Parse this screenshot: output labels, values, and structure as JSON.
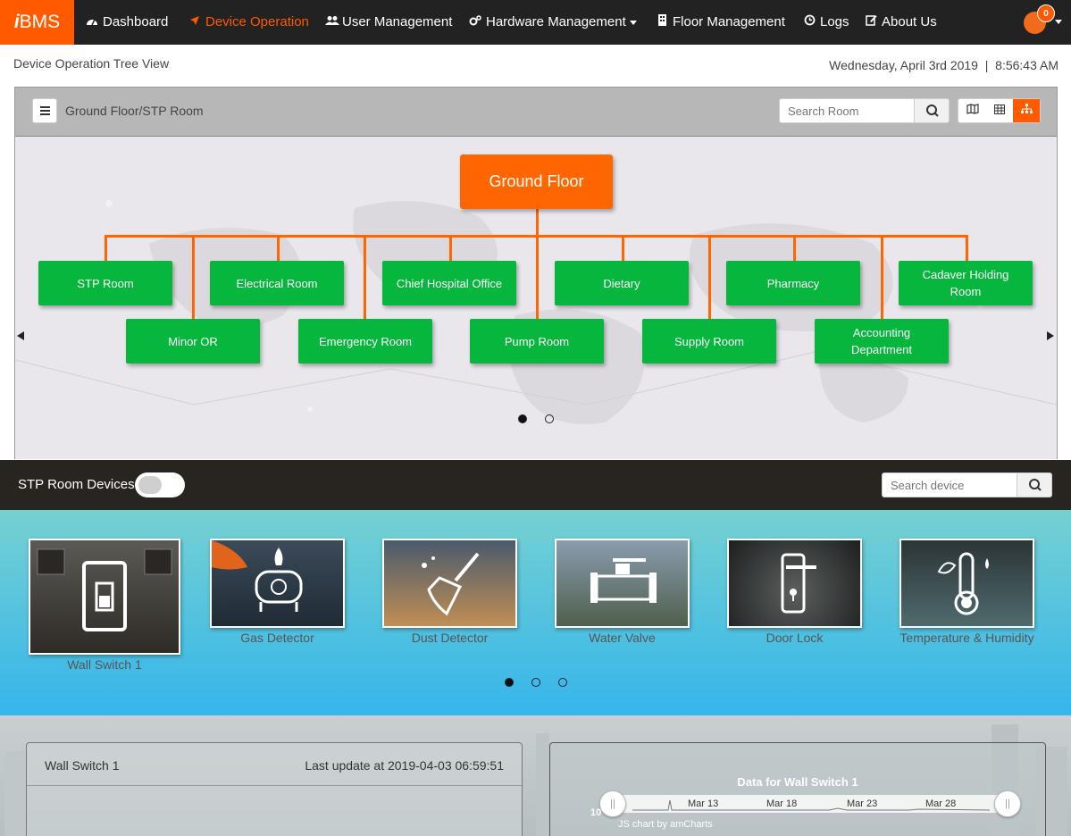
{
  "brand": {
    "prefix": "i",
    "name": "BMS"
  },
  "nav": {
    "dashboard": "Dashboard",
    "device_operation": "Device Operation",
    "user_management": "User Management",
    "hardware_management": "Hardware Management",
    "floor_management": "Floor Management",
    "logs": "Logs",
    "about_us": "About Us",
    "notification_count": "0"
  },
  "page": {
    "title": "Device Operation Tree View",
    "date": "Wednesday, April 3rd 2019",
    "separator": "|",
    "time": "8:56:43 AM"
  },
  "tree": {
    "breadcrumb": "Ground Floor/STP Room",
    "search_placeholder": "Search Room",
    "root": "Ground Floor",
    "rooms": [
      "STP Room",
      "Minor OR",
      "Electrical Room",
      "Emergency Room",
      "Chief Hospital Office",
      "Pump Room",
      "Dietary",
      "Supply Room",
      "Pharmacy",
      "Accounting Department",
      "Cadaver Holding Room"
    ]
  },
  "devices": {
    "title": "STP Room Devices",
    "search_placeholder": "Search device",
    "items": [
      {
        "label": "Wall Switch 1",
        "icon": "wall-switch-icon"
      },
      {
        "label": "Gas Detector",
        "icon": "gas-detector-icon"
      },
      {
        "label": "Dust Detector",
        "icon": "dust-broom-icon"
      },
      {
        "label": "Water Valve",
        "icon": "water-valve-icon"
      },
      {
        "label": "Door Lock",
        "icon": "door-lock-icon"
      },
      {
        "label": "Temperature & Humidity",
        "icon": "thermometer-icon"
      }
    ]
  },
  "detail": {
    "device_title": "Wall Switch 1",
    "last_update": "Last update at 2019-04-03 06:59:51"
  },
  "chart_data": {
    "type": "line",
    "title": "Data for Wall Switch 1",
    "x_ticks": [
      "Mar 13",
      "Mar 18",
      "Mar 23",
      "Mar 28"
    ],
    "y_tick_visible": "10",
    "credit": "JS chart by amCharts"
  },
  "colors": {
    "accent": "#ff5a00",
    "room_node": "#07b63d",
    "navbar": "#222222"
  }
}
